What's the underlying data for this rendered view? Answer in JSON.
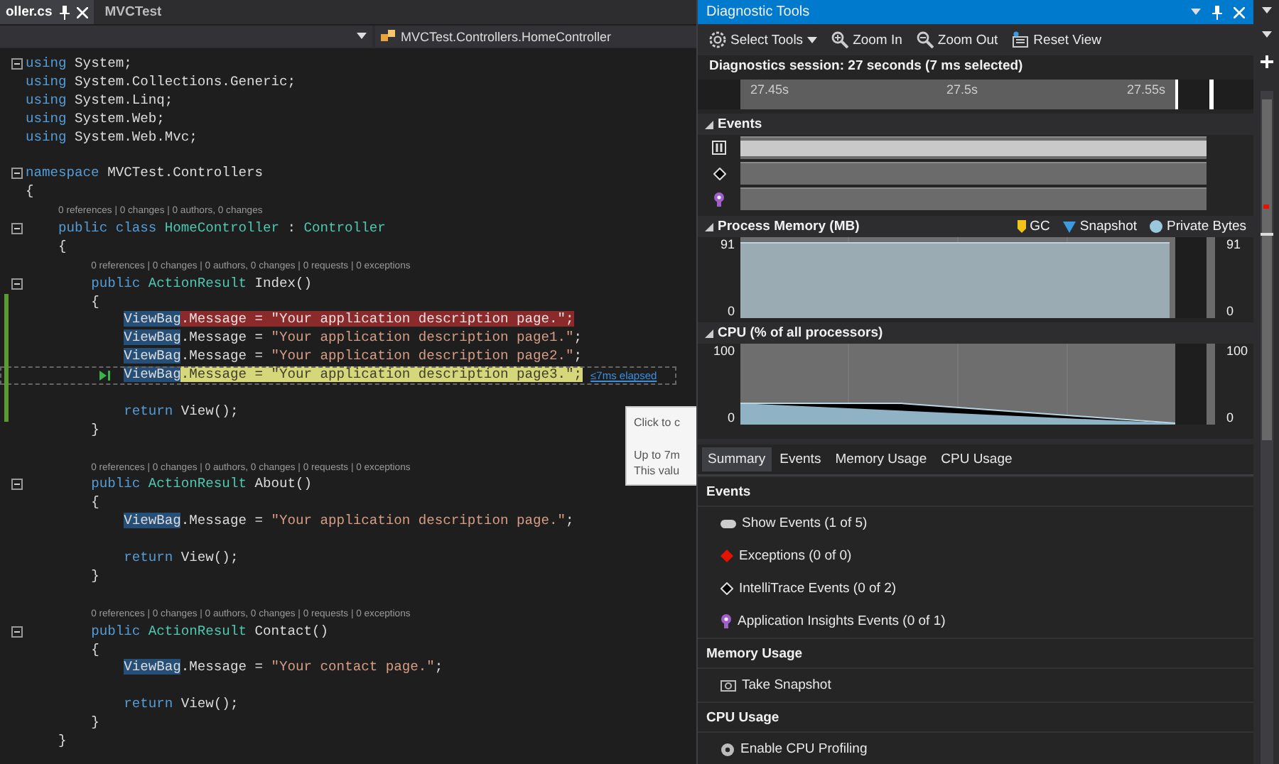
{
  "editor": {
    "tabs": [
      {
        "label": "oller.cs",
        "selected": true
      },
      {
        "label": "MVCTest",
        "selected": false
      }
    ],
    "navigator": "MVCTest.Controllers.HomeController",
    "lines": [
      {
        "kind": "code",
        "fold": true,
        "tokens": [
          {
            "kind": "keyword",
            "text": "using"
          },
          {
            "kind": "plain",
            "text": " System;"
          }
        ]
      },
      {
        "kind": "code",
        "tokens": [
          {
            "kind": "keyword",
            "text": "using"
          },
          {
            "kind": "plain",
            "text": " System.Collections.Generic;"
          }
        ]
      },
      {
        "kind": "code",
        "tokens": [
          {
            "kind": "keyword",
            "text": "using"
          },
          {
            "kind": "plain",
            "text": " System.Linq;"
          }
        ]
      },
      {
        "kind": "code",
        "tokens": [
          {
            "kind": "keyword",
            "text": "using"
          },
          {
            "kind": "plain",
            "text": " System.Web;"
          }
        ]
      },
      {
        "kind": "code",
        "tokens": [
          {
            "kind": "keyword",
            "text": "using"
          },
          {
            "kind": "plain",
            "text": " System.Web.Mvc;"
          }
        ]
      },
      {
        "kind": "blank"
      },
      {
        "kind": "code",
        "fold": true,
        "tokens": [
          {
            "kind": "keyword",
            "text": "namespace"
          },
          {
            "kind": "plain",
            "text": " MVCTest.Controllers"
          }
        ]
      },
      {
        "kind": "code",
        "tokens": [
          {
            "kind": "plain",
            "text": "{"
          }
        ]
      },
      {
        "kind": "lens",
        "text": "    0 references | 0 changes | 0 authors, 0 changes"
      },
      {
        "kind": "code",
        "fold": true,
        "tokens": [
          {
            "kind": "keyword",
            "text": "    public class"
          },
          {
            "kind": "type",
            "text": " HomeController"
          },
          {
            "kind": "plain",
            "text": " : "
          },
          {
            "kind": "type",
            "text": "Controller"
          }
        ]
      },
      {
        "kind": "code",
        "tokens": [
          {
            "kind": "plain",
            "text": "    {"
          }
        ]
      },
      {
        "kind": "lens",
        "text": "        0 references | 0 changes | 0 authors, 0 changes | 0 requests | 0 exceptions"
      },
      {
        "kind": "code",
        "fold": true,
        "tokens": [
          {
            "kind": "keyword",
            "text": "        public"
          },
          {
            "kind": "type",
            "text": " ActionResult"
          },
          {
            "kind": "plain",
            "text": " Index()"
          }
        ]
      },
      {
        "kind": "code",
        "changed": true,
        "tokens": [
          {
            "kind": "plain",
            "text": "        {"
          }
        ]
      },
      {
        "kind": "code",
        "changed": true,
        "error": true,
        "tokens": [
          {
            "kind": "ref",
            "text": "            ViewBag"
          },
          {
            "kind": "plain",
            "text": ".Message = "
          },
          {
            "kind": "string",
            "text": "\"Your application description page.\""
          },
          {
            "kind": "plain",
            "text": ";"
          }
        ]
      },
      {
        "kind": "code",
        "changed": true,
        "tokens": [
          {
            "kind": "ref",
            "text": "            ViewBag"
          },
          {
            "kind": "plain",
            "text": ".Message = "
          },
          {
            "kind": "string",
            "text": "\"Your application description page1.\""
          },
          {
            "kind": "plain",
            "text": ";"
          }
        ]
      },
      {
        "kind": "code",
        "changed": true,
        "tokens": [
          {
            "kind": "ref",
            "text": "            ViewBag"
          },
          {
            "kind": "plain",
            "text": ".Message = "
          },
          {
            "kind": "string",
            "text": "\"Your application description page2.\""
          },
          {
            "kind": "plain",
            "text": ";"
          }
        ]
      },
      {
        "kind": "code",
        "changed": true,
        "current": true,
        "perf": "≤7ms elapsed",
        "tokens": [
          {
            "kind": "ref",
            "text": "            ViewBag"
          },
          {
            "kind": "plain",
            "text": ".Message = "
          },
          {
            "kind": "string",
            "text": "\"Your application description page3.\""
          },
          {
            "kind": "plain",
            "text": ";"
          }
        ]
      },
      {
        "kind": "blank",
        "changed": true
      },
      {
        "kind": "code",
        "changed": true,
        "tokens": [
          {
            "kind": "keyword",
            "text": "            return"
          },
          {
            "kind": "plain",
            "text": " View();"
          }
        ]
      },
      {
        "kind": "code",
        "tokens": [
          {
            "kind": "plain",
            "text": "        }"
          }
        ]
      },
      {
        "kind": "blank"
      },
      {
        "kind": "lens",
        "text": "        0 references | 0 changes | 0 authors, 0 changes | 0 requests | 0 exceptions"
      },
      {
        "kind": "code",
        "fold": true,
        "tokens": [
          {
            "kind": "keyword",
            "text": "        public"
          },
          {
            "kind": "type",
            "text": " ActionResult"
          },
          {
            "kind": "plain",
            "text": " About()"
          }
        ]
      },
      {
        "kind": "code",
        "tokens": [
          {
            "kind": "plain",
            "text": "        {"
          }
        ]
      },
      {
        "kind": "code",
        "tokens": [
          {
            "kind": "ref",
            "text": "            ViewBag"
          },
          {
            "kind": "plain",
            "text": ".Message = "
          },
          {
            "kind": "string",
            "text": "\"Your application description page.\""
          },
          {
            "kind": "plain",
            "text": ";"
          }
        ]
      },
      {
        "kind": "blank"
      },
      {
        "kind": "code",
        "tokens": [
          {
            "kind": "keyword",
            "text": "            return"
          },
          {
            "kind": "plain",
            "text": " View();"
          }
        ]
      },
      {
        "kind": "code",
        "tokens": [
          {
            "kind": "plain",
            "text": "        }"
          }
        ]
      },
      {
        "kind": "blank"
      },
      {
        "kind": "lens",
        "text": "        0 references | 0 changes | 0 authors, 0 changes | 0 requests | 0 exceptions"
      },
      {
        "kind": "code",
        "fold": true,
        "tokens": [
          {
            "kind": "keyword",
            "text": "        public"
          },
          {
            "kind": "type",
            "text": " ActionResult"
          },
          {
            "kind": "plain",
            "text": " Contact()"
          }
        ]
      },
      {
        "kind": "code",
        "tokens": [
          {
            "kind": "plain",
            "text": "        {"
          }
        ]
      },
      {
        "kind": "code",
        "tokens": [
          {
            "kind": "ref",
            "text": "            ViewBag"
          },
          {
            "kind": "plain",
            "text": ".Message = "
          },
          {
            "kind": "string",
            "text": "\"Your contact page.\""
          },
          {
            "kind": "plain",
            "text": ";"
          }
        ]
      },
      {
        "kind": "blank"
      },
      {
        "kind": "code",
        "tokens": [
          {
            "kind": "keyword",
            "text": "            return"
          },
          {
            "kind": "plain",
            "text": " View();"
          }
        ]
      },
      {
        "kind": "code",
        "tokens": [
          {
            "kind": "plain",
            "text": "        }"
          }
        ]
      },
      {
        "kind": "code",
        "tokens": [
          {
            "kind": "plain",
            "text": "    }"
          }
        ]
      }
    ],
    "tooltip": [
      "Click to c",
      "Up to 7m",
      "This valu"
    ]
  },
  "diagnostics": {
    "title": "Diagnostic Tools",
    "toolbar": [
      {
        "label": "Select Tools",
        "kind": "settings"
      },
      {
        "label": "Zoom In",
        "kind": "zoom-in"
      },
      {
        "label": "Zoom Out",
        "kind": "zoom-out"
      },
      {
        "label": "Reset View",
        "kind": "reset"
      }
    ],
    "session": "Diagnostics session: 27 seconds (7 ms selected)",
    "ruler_ticks": [
      "27.45s",
      "27.5s",
      "27.55s"
    ],
    "events": {
      "label": "Events",
      "expanded": true
    },
    "memory": {
      "label": "Process Memory (MB)",
      "expanded": true,
      "left_axis": [
        "91",
        "0"
      ],
      "right_axis": [
        "91",
        "0"
      ],
      "legend": [
        {
          "label": "GC",
          "kind": "gc"
        },
        {
          "label": "Snapshot",
          "kind": "snapshot"
        },
        {
          "label": "Private Bytes",
          "kind": "bytes"
        }
      ]
    },
    "cpu": {
      "label": "CPU (% of all processors)",
      "expanded": true,
      "left_axis": [
        "100",
        "0"
      ],
      "right_axis": [
        "100",
        "0"
      ]
    },
    "tabs": [
      {
        "label": "Summary",
        "selected": true
      },
      {
        "label": "Events",
        "selected": false
      },
      {
        "label": "Memory Usage",
        "selected": false
      },
      {
        "label": "CPU Usage",
        "selected": false
      }
    ],
    "summary": [
      {
        "heading": "Events",
        "items": [
          {
            "label": "Show Events (1 of 5)",
            "kind": "show"
          },
          {
            "label": "Exceptions (0 of 0)",
            "kind": "exception"
          },
          {
            "label": "IntelliTrace Events (0 of 2)",
            "kind": "intellitrace"
          },
          {
            "label": "Application Insights Events (0 of 1)",
            "kind": "insights"
          }
        ]
      },
      {
        "heading": "Memory Usage",
        "items": [
          {
            "label": "Take Snapshot",
            "kind": "snapshot"
          }
        ]
      },
      {
        "heading": "CPU Usage",
        "items": [
          {
            "label": "Enable CPU Profiling",
            "kind": "profiling"
          }
        ]
      }
    ]
  }
}
